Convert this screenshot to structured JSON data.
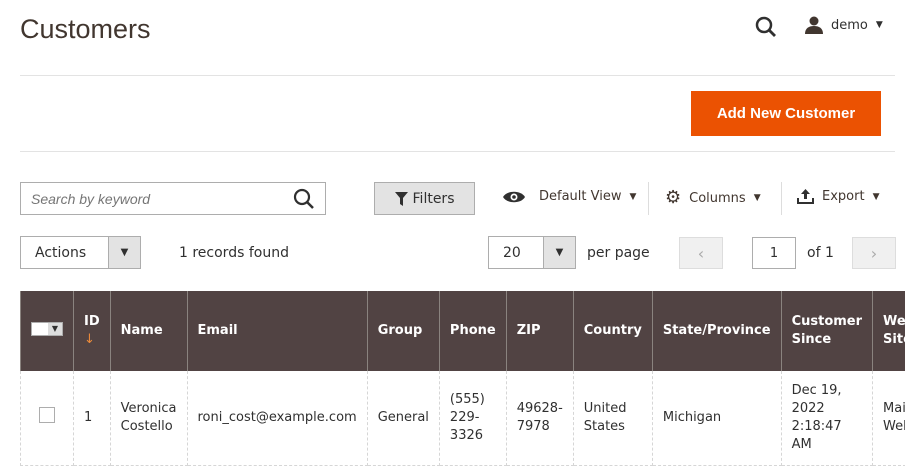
{
  "header": {
    "title": "Customers",
    "user": "demo"
  },
  "actions": {
    "add_new": "Add New Customer"
  },
  "toolbar": {
    "search_placeholder": "Search by keyword",
    "filters": "Filters",
    "view": "Default View",
    "columns": "Columns",
    "export": "Export"
  },
  "grid": {
    "mass_actions": "Actions",
    "records_found": "1 records found",
    "per_page_value": "20",
    "per_page_label": "per page",
    "page": "1",
    "page_of": "of 1"
  },
  "columns": [
    "ID",
    "Name",
    "Email",
    "Group",
    "Phone",
    "ZIP",
    "Country",
    "State/Province",
    "Customer Since",
    "Web Site"
  ],
  "rows": [
    {
      "id": "1",
      "name": "Veronica Costello",
      "email": "roni_cost@example.com",
      "group": "General",
      "phone": "(555) 229-3326",
      "zip": "49628-7978",
      "country": "United States",
      "state": "Michigan",
      "since": "Dec 19, 2022 2:18:47 AM",
      "website": "Main Website"
    }
  ],
  "colors": {
    "accent": "#eb5202",
    "header_bg": "#514343"
  }
}
